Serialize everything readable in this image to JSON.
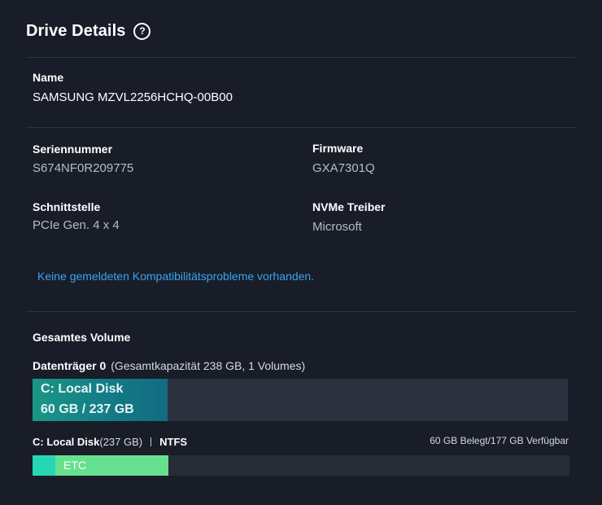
{
  "header": {
    "title": "Drive Details",
    "help_icon": "?"
  },
  "name": {
    "label": "Name",
    "value": "SAMSUNG MZVL2256HCHQ-00B00"
  },
  "details": {
    "serial_label": "Seriennummer",
    "serial_value": "S674NF0R209775",
    "firmware_label": "Firmware",
    "firmware_value": "GXA7301Q",
    "interface_label": "Schnittstelle",
    "interface_value": "PCIe Gen. 4 x 4",
    "driver_label": "NVMe Treiber",
    "driver_value": "Microsoft"
  },
  "compatibility_notice": "Keine gemeldeten Kompatibilitätsprobleme vorhanden.",
  "volume": {
    "section_label": "Gesamtes Volume",
    "disk_name": "Datenträger 0",
    "disk_meta": "(Gesamtkapazität 238 GB, 1 Volumes)",
    "volume_name": "C: Local Disk",
    "volume_size": "60 GB / 237 GB",
    "used_gb": 60,
    "capacity_gb": 238
  },
  "partition": {
    "name": "C: Local Disk",
    "size": "(237 GB)",
    "filesystem": "NTFS",
    "usage": "60 GB Belegt/177 GB Verfügbar",
    "total_gb": 237,
    "segments": [
      {
        "name": "system",
        "label": "",
        "gb": 10,
        "color": "#27d7b3"
      },
      {
        "name": "etc",
        "label": "ETC",
        "gb": 50,
        "color": "#66e08f"
      }
    ]
  },
  "colors": {
    "background": "#181d28",
    "accent_link": "#3aa3f0",
    "volume_fill": "#137b86"
  }
}
